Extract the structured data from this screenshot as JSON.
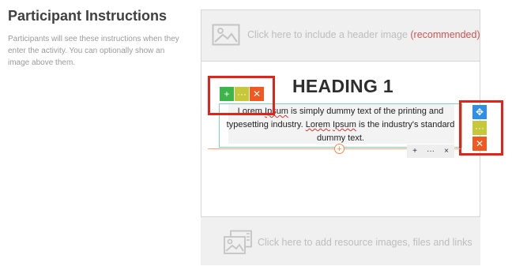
{
  "left_panel": {
    "title": "Participant Instructions",
    "description": "Participants will see these instructions when they enter the activity. You can optionally show an image above them."
  },
  "header_image": {
    "icon": "image-icon",
    "prompt": "Click here to include a header image",
    "recommended": "(recommended)"
  },
  "content": {
    "heading": "HEADING 1",
    "paragraph_parts": [
      "Lorem ",
      "Ipsum",
      " is simply dummy text of the printing and typesetting industry. ",
      "Lorem",
      " ",
      "Ipsum",
      " is the industry's standard dummy text."
    ]
  },
  "block_toolbar": {
    "add": "+",
    "more": "···",
    "delete": "✕"
  },
  "side_toolbar": {
    "move": "✥",
    "more": "···",
    "delete": "✕"
  },
  "insert": {
    "plus": "+"
  },
  "mini_toolbar": {
    "add": "+",
    "more": "···",
    "close": "×"
  },
  "resources": {
    "icon": "gallery-icon",
    "prompt": "Click here to add resource images, files and links"
  },
  "colors": {
    "add_green": "#3db54a",
    "more_yellow": "#c7c73a",
    "delete_orange": "#f05a22",
    "move_blue": "#2f8fe6",
    "highlight_red": "#e2231a",
    "recommended_red": "#cc5555"
  }
}
